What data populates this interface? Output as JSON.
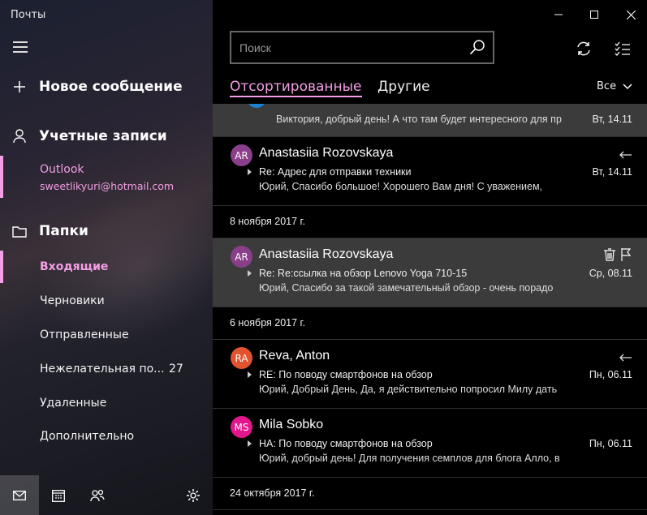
{
  "app": {
    "title": "Почты"
  },
  "sidebar": {
    "new_message": "Новое сообщение",
    "accounts_label": "Учетные записи",
    "account": {
      "name": "Outlook",
      "email": "sweetlikyuri@hotmail.com"
    },
    "folders_label": "Папки",
    "folders": [
      {
        "label": "Входящие",
        "count": ""
      },
      {
        "label": "Черновики",
        "count": ""
      },
      {
        "label": "Отправленные",
        "count": ""
      },
      {
        "label": "Нежелательная по...",
        "count": "27"
      },
      {
        "label": "Удаленные",
        "count": ""
      },
      {
        "label": "Дополнительно",
        "count": ""
      }
    ]
  },
  "search": {
    "placeholder": "Поиск"
  },
  "tabs": {
    "focused": "Отсортированные",
    "other": "Другие"
  },
  "filter": {
    "label": "Все"
  },
  "messages": [
    {
      "sender": "",
      "subject": "",
      "preview": "Виктория, добрый день!    А что там будет интересного для пр",
      "date": "Вт, 14.11",
      "initials": "",
      "avatar_color": "#1e7fd6"
    },
    {
      "sender": "Anastasiia Rozovskaya",
      "subject": "Re: Адрес для отправки техники",
      "preview": "Юрий,    Спасибо большое!  Хорошего Вам дня!    С уважением,",
      "date": "Вт, 14.11",
      "initials": "AR",
      "avatar_color": "#8b3f8a"
    },
    {
      "sender": "Anastasiia Rozovskaya",
      "subject": "Re: Re:ссылка на обзор Lenovo Yoga 710-15",
      "preview": "Юрий,     Спасибо за такой замечательный обзор - очень порадо",
      "date": "Ср, 08.11",
      "initials": "AR",
      "avatar_color": "#8b3f8a"
    },
    {
      "sender": "Reva, Anton",
      "subject": "RE: По поводу смартфонов на обзор",
      "preview": "Юрий, Добрый День,     Да, я действительно попросил Милу дать",
      "date": "Пн, 06.11",
      "initials": "RA",
      "avatar_color": "#e0532e"
    },
    {
      "sender": "Mila Sobko",
      "subject": "HA: По поводу смартфонов на обзор",
      "preview": "Юрий, добрый день!     Для получения семплов для блога Алло, в",
      "date": "Пн, 06.11",
      "initials": "MS",
      "avatar_color": "#e3168c"
    }
  ],
  "groups": [
    "8 ноября 2017 г.",
    "6 ноября 2017 г.",
    "24 октября 2017 г."
  ],
  "accent_color": "#f39ee5"
}
